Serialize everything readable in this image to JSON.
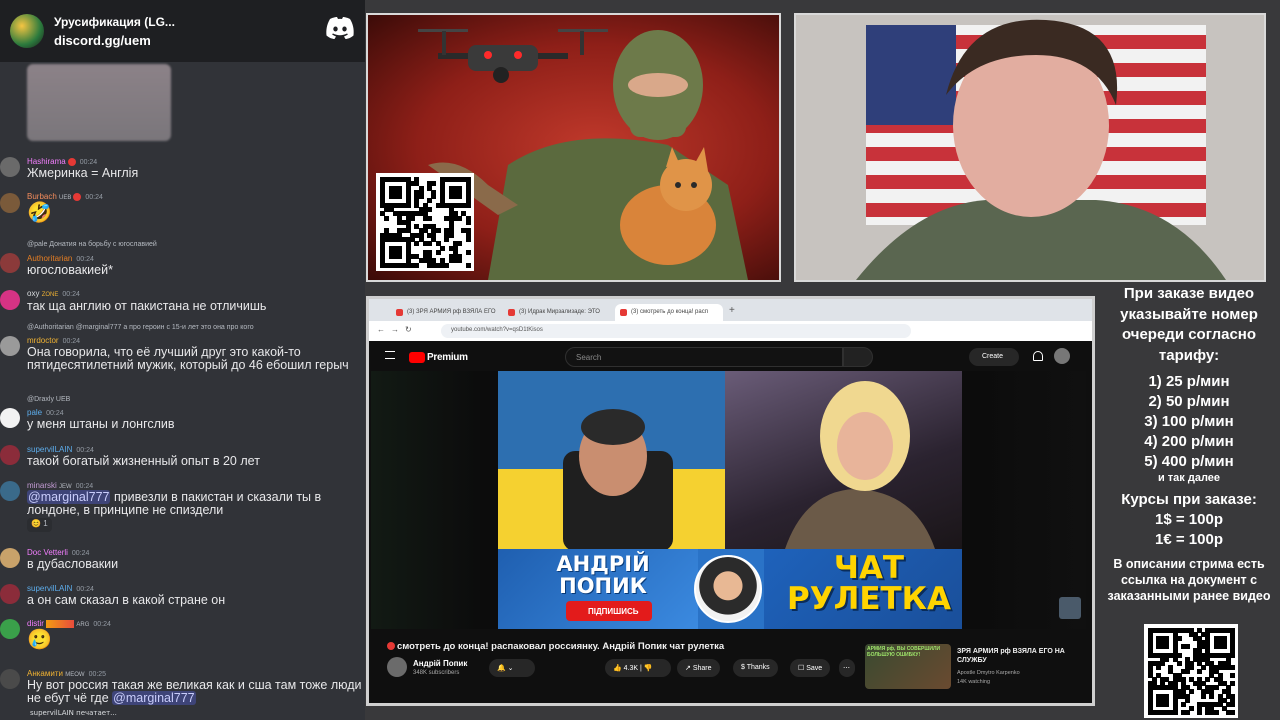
{
  "discord": {
    "server_name": "Урусификация (LG...",
    "invite": "discord.gg/uem",
    "typing": "supervilLAIN печатает..."
  },
  "messages": [
    {
      "user": "Hashirama",
      "time": "00:24",
      "text": "Жмеринка = Англія",
      "color": "#f47fff"
    },
    {
      "user": "Burbach",
      "tag": "UEB",
      "time": "00:24",
      "text": "🤣",
      "color": "#f28b5b"
    },
    {
      "reply": "@pale Донатия на борьбу с югославией",
      "user": "Authoritarian",
      "time": "00:24",
      "text": "югословакией*",
      "color": "#e67e22"
    },
    {
      "user": "oxy",
      "tag": "ZONE",
      "time": "00:24",
      "text": "так ща англию от пакистана не отличишь",
      "color": "#dbdee1"
    },
    {
      "reply": "@Authoritarian @marginal777 а про героин с 15-и лет это она про кого",
      "user": "mrdoctor",
      "time": "00:24",
      "text": "Она говорила, что её лучший друг это какой-то пятидесятилетний мужик, который до 46 ебошил герыч",
      "color": "#f0b232"
    },
    {
      "reply": "@Draxly UEB",
      "user": "pale",
      "time": "00:24",
      "text": "у меня штаны и лонгслив",
      "color": "#5dadec"
    },
    {
      "user": "supervilLAIN",
      "time": "00:24",
      "text": "такой богатый жизненный опыт в 20 лет",
      "color": "#5dadec"
    },
    {
      "user": "minarski",
      "tag": "JEW",
      "time": "00:24",
      "mention": "@marginal777",
      "text": " привезли в пакистан и сказали ты в лондоне,  в принципе не спиздели",
      "color": "#c39bd3",
      "reaction": "1"
    },
    {
      "user": "Doc Vetterli",
      "time": "00:24",
      "text": "в дубасловакии",
      "color": "#f47fff"
    },
    {
      "user": "supervilLAIN",
      "time": "00:24",
      "text": "а он сам сказал в какой стране он",
      "color": "#5dadec"
    },
    {
      "user": "distir",
      "tag": "ARG",
      "time": "00:24",
      "text": "🥲",
      "color": "#f47fff"
    },
    {
      "user": "Анкамити",
      "tag": "MEOW",
      "time": "00:25",
      "text": "Ну вот россия такая же великая как и сша там тоже люди не ебут чё где ",
      "mention": "@marginal777",
      "color": "#f0b232"
    }
  ],
  "browser": {
    "tabs": [
      "(3) ЗРЯ АРМИЯ рф ВЗЯЛА ЕГО",
      "(3) Идрак Мирзализаде: ЭТО",
      "(3) смотреть до конца! расп"
    ],
    "url": "youtube.com/watch?v=qsD1tKisos"
  },
  "youtube": {
    "brand": "Premium",
    "search_placeholder": "Search",
    "create": "Create",
    "notif_count": "3",
    "banner_name": "АНДРІЙ ПОПИК",
    "subscribe": "ПІДПИШИСЬ",
    "banner_title": "ЧАТ РУЛЕТКА",
    "video_title": "смотреть до конца! распаковал россиянку. Андрій Попик чат рулетка",
    "channel": "Андрій Попик",
    "subscribers": "348K subscribers",
    "likes": "4.3K",
    "share": "Share",
    "thanks": "Thanks",
    "save": "Save",
    "sidebar": {
      "title": "ЗРЯ АРМИЯ рф ВЗЯЛА ЕГО НА СЛУЖБУ",
      "channel": "Apostle Dmytro Karpenko",
      "meta": "14K watching",
      "thumb_caption": "АРМИЯ рф, ВЫ СОВЕРШИЛИ БОЛЬШУЮ ОШИБКУ!"
    }
  },
  "info": {
    "order_text": "При заказе видео указывайте номер очереди согласно тарифу:",
    "tariffs": [
      "1) 25 р/мин",
      "2) 50 р/мин",
      "3) 100 р/мин",
      "4) 200 р/мин",
      "5) 400 р/мин"
    ],
    "etc": "и так далее",
    "rates_title": "Курсы при заказе:",
    "rates": [
      "1$ = 100р",
      "1€ = 100р"
    ],
    "description": "В описании стрима есть ссылка на документ с заказанными ранее видео"
  }
}
